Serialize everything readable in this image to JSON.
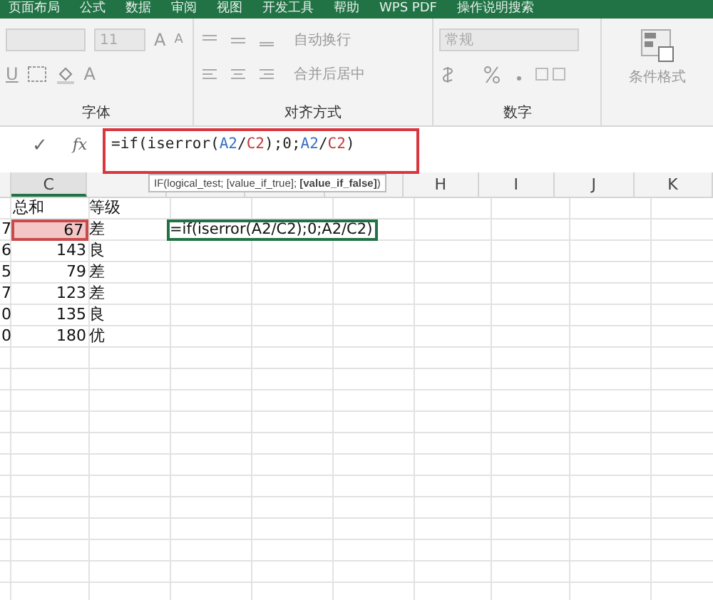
{
  "menu_tabs": [
    "页面布局",
    "公式",
    "数据",
    "审阅",
    "视图",
    "开发工具",
    "帮助",
    "WPS PDF",
    "操作说明搜索"
  ],
  "ribbon": {
    "grow_font": "A",
    "shrink_font": "A",
    "underline": "U",
    "font_color": "A",
    "font_size": "11",
    "font_group": "字体",
    "wrap_text": "自动换行",
    "merge_center": "合并后居中",
    "alignment_group": "对齐方式",
    "number_format": "常规",
    "number_group": "数字",
    "conditional_format": "条件格式"
  },
  "formula_bar": {
    "enter_icon": "✓",
    "function_icon": "fx",
    "segments": [
      {
        "text": "=if(iserror(",
        "color": "#222222"
      },
      {
        "text": "A2",
        "color": "#3a6fc4"
      },
      {
        "text": "/",
        "color": "#222222"
      },
      {
        "text": "C2",
        "color": "#c43a3a"
      },
      {
        "text": ");0;",
        "color": "#222222"
      },
      {
        "text": "A2",
        "color": "#3a6fc4"
      },
      {
        "text": "/",
        "color": "#222222"
      },
      {
        "text": "C2",
        "color": "#c43a3a"
      },
      {
        "text": ")",
        "color": "#222222"
      }
    ]
  },
  "tooltip": "IF(logical_test; [value_if_true]; **[value_if_false]**)",
  "columns": [
    {
      "selected": false
    },
    {
      "label": "C",
      "selected": true
    },
    {
      "selected": false
    },
    {
      "selected": false
    },
    {
      "selected": false
    },
    {
      "selected": false
    },
    {
      "label": "H",
      "selected": false
    },
    {
      "label": "I",
      "selected": false
    },
    {
      "label": "J",
      "selected": false
    },
    {
      "label": "K",
      "selected": false
    }
  ],
  "rows": [
    {
      "col_c": "总和",
      "col_d": "等级",
      "c_selected": false
    },
    {
      "col_b": "7",
      "col_c": "67",
      "col_d": "差",
      "col_e": "=if(iserror(A2/C2);0;A2/C2)",
      "c_selected": true
    },
    {
      "col_b": "6",
      "col_c": "143",
      "col_d": "良",
      "c_selected": false
    },
    {
      "col_b": "5",
      "col_c": "79",
      "col_d": "差",
      "c_selected": false
    },
    {
      "col_b": "7",
      "col_c": "123",
      "col_d": "差",
      "c_selected": false
    },
    {
      "col_b": "0",
      "col_c": "135",
      "col_d": "良",
      "c_selected": false
    },
    {
      "col_b": "0",
      "col_c": "180",
      "col_d": "优",
      "c_selected": false
    }
  ]
}
